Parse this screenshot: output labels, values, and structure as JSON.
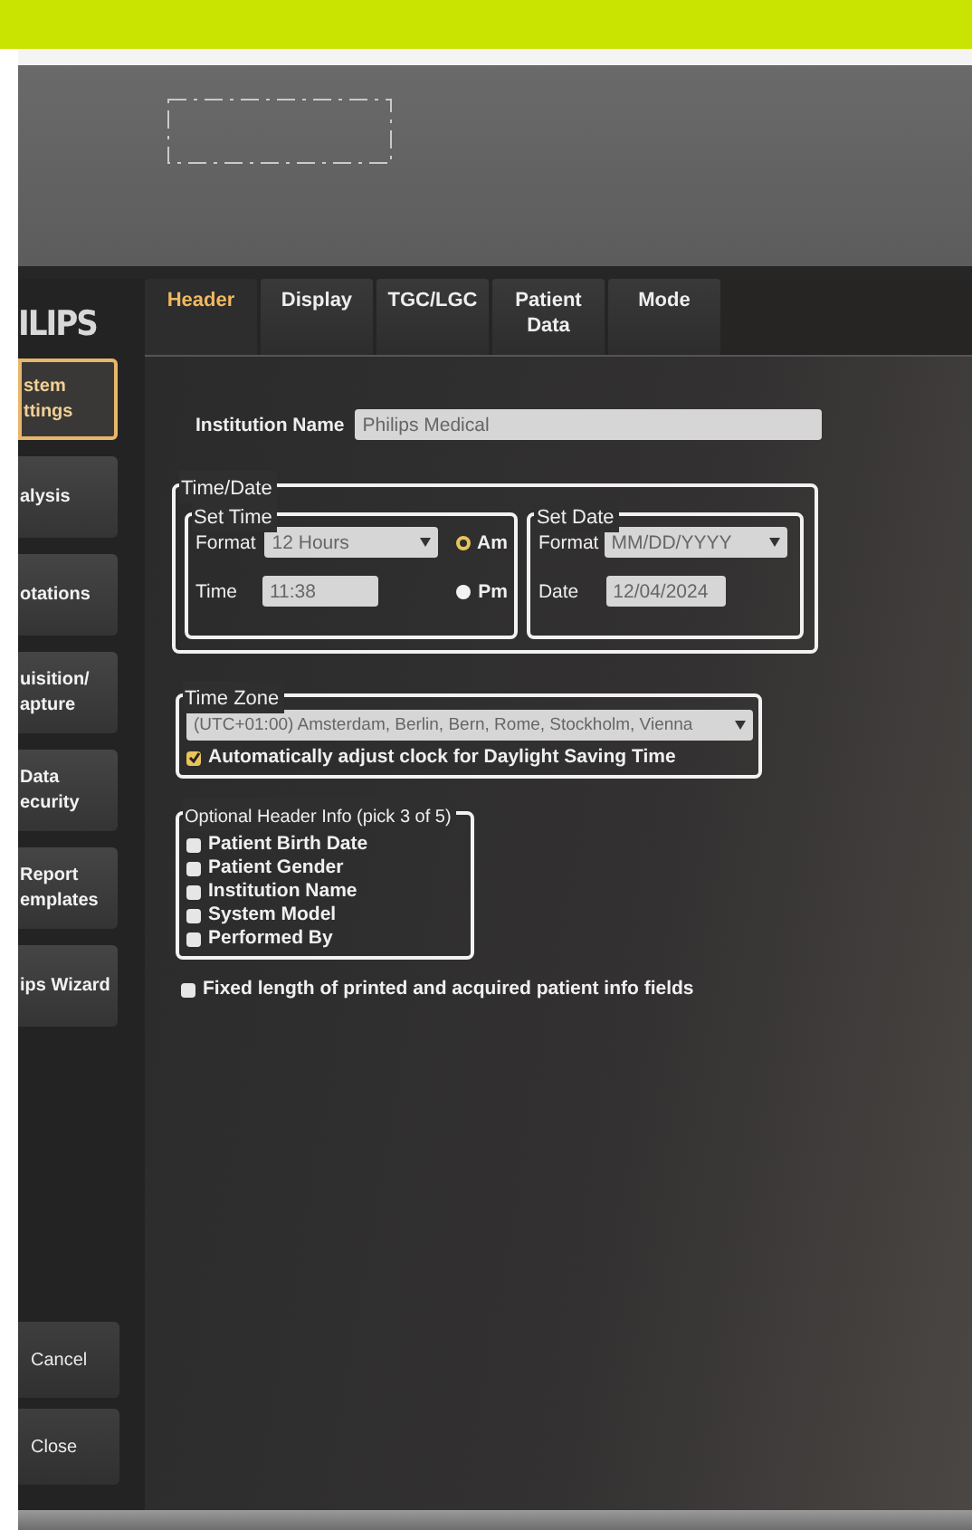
{
  "brand": "ILIPS",
  "sidebar": {
    "items": [
      {
        "label": "stem\nttings",
        "selected": true
      },
      {
        "label": "alysis",
        "selected": false
      },
      {
        "label": "otations",
        "selected": false
      },
      {
        "label": "uisition/\napture",
        "selected": false
      },
      {
        "label": "Data\necurity",
        "selected": false
      },
      {
        "label": "Report\nemplates",
        "selected": false
      },
      {
        "label": "ips Wizard",
        "selected": false
      }
    ],
    "buttons": [
      "Cancel",
      "Close"
    ]
  },
  "tabs": [
    {
      "label": "Header",
      "selected": true
    },
    {
      "label": "Display",
      "selected": false
    },
    {
      "label": "TGC/LGC",
      "selected": false
    },
    {
      "label": "Patient\nData",
      "selected": false
    },
    {
      "label": "Mode",
      "selected": false
    }
  ],
  "institution_name": {
    "label": "Institution Name",
    "value": "Philips Medical"
  },
  "time_date": {
    "title": "Time/Date",
    "set_time": {
      "title": "Set Time",
      "format_label": "Format",
      "format_value": "12 Hours",
      "time_label": "Time",
      "time_value": "11:38",
      "options": [
        {
          "label": "Am",
          "selected": true
        },
        {
          "label": "Pm",
          "selected": false
        }
      ]
    },
    "set_date": {
      "title": "Set Date",
      "format_label": "Format",
      "format_value": "MM/DD/YYYY",
      "date_label": "Date",
      "date_value": "12/04/2024"
    }
  },
  "time_zone": {
    "title": "Time Zone",
    "value": "(UTC+01:00) Amsterdam, Berlin, Bern, Rome, Stockholm, Vienna",
    "dst": {
      "label": "Automatically adjust clock for Daylight Saving Time",
      "checked": true
    }
  },
  "optional_header": {
    "title": "Optional Header Info (pick 3 of 5)",
    "items": [
      {
        "label": "Patient Birth Date",
        "checked": false
      },
      {
        "label": "Patient Gender",
        "checked": false
      },
      {
        "label": "Institution Name",
        "checked": false
      },
      {
        "label": "System Model",
        "checked": false
      },
      {
        "label": "Performed By",
        "checked": false
      }
    ]
  },
  "fixed_length": {
    "label": "Fixed length of printed and acquired patient info fields",
    "checked": false
  }
}
